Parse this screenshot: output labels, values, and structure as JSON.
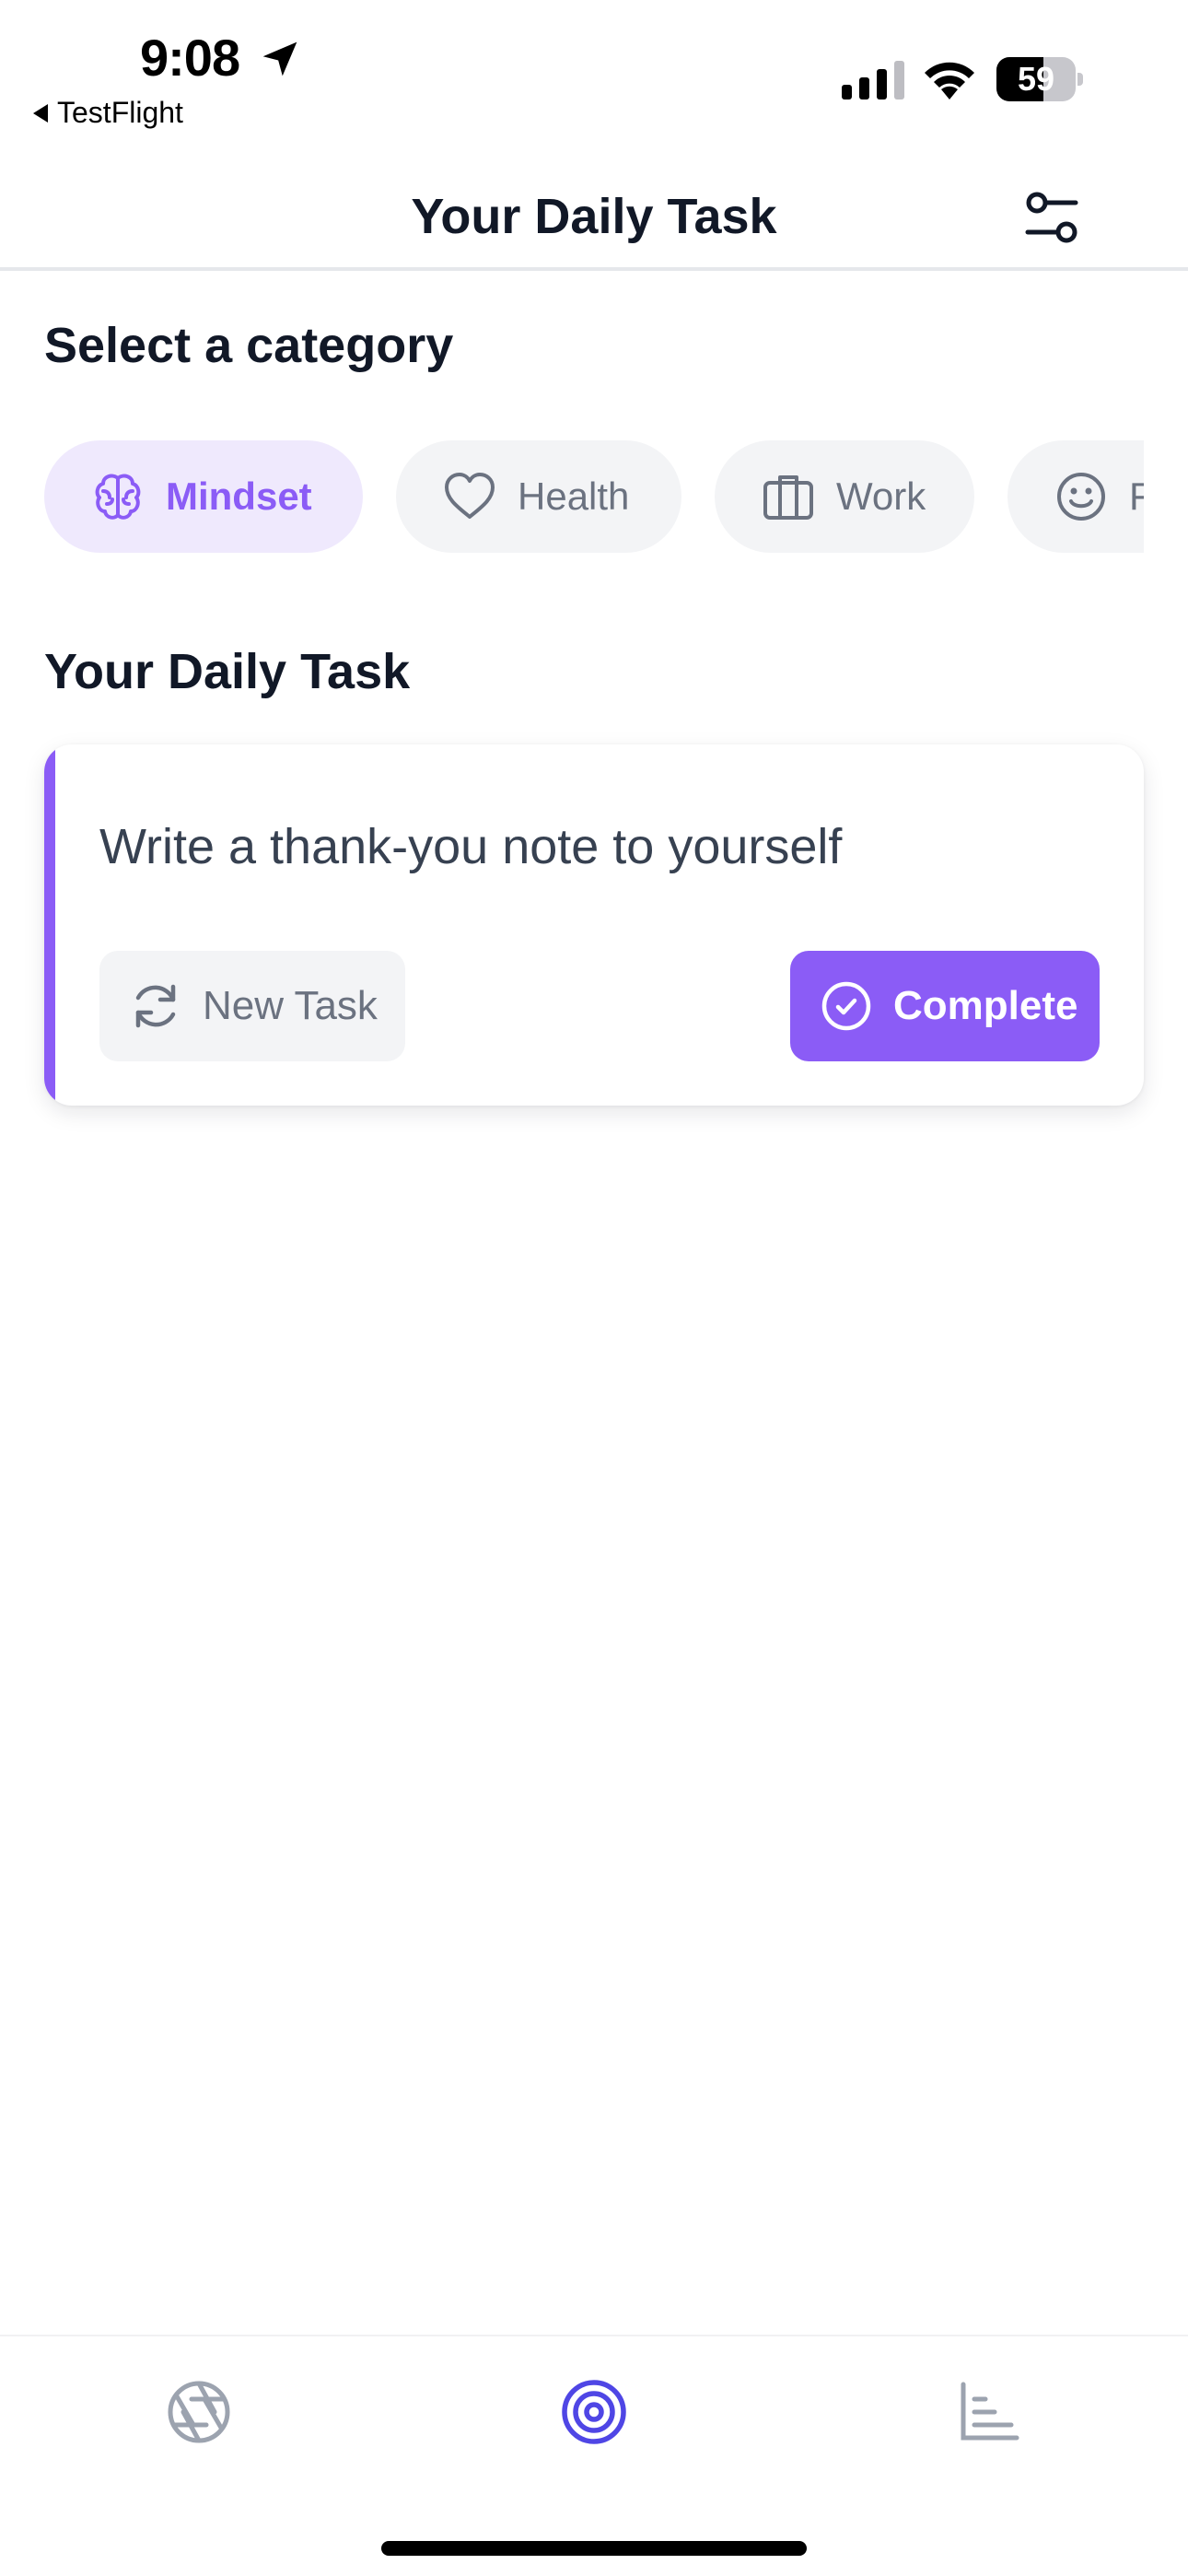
{
  "status_bar": {
    "time": "9:08",
    "back_app": "TestFlight",
    "battery_level": "59",
    "battery_fraction": 0.59
  },
  "header": {
    "title": "Your Daily Task",
    "filter_icon": "sliders-icon"
  },
  "categories": {
    "title": "Select a category",
    "items": [
      {
        "label": "Mindset",
        "icon": "brain-icon",
        "active": true
      },
      {
        "label": "Health",
        "icon": "heart-icon",
        "active": false
      },
      {
        "label": "Work",
        "icon": "briefcase-icon",
        "active": false
      },
      {
        "label": "F",
        "icon": "smile-icon",
        "active": false
      }
    ]
  },
  "daily_task": {
    "title": "Your Daily Task",
    "task_text": "Write a thank-you note to yourself",
    "new_task_label": "New Task",
    "complete_label": "Complete"
  },
  "tab_bar": {
    "items": [
      {
        "icon": "aperture-icon",
        "active": false
      },
      {
        "icon": "target-icon",
        "active": true
      },
      {
        "icon": "bar-chart-icon",
        "active": false
      }
    ]
  },
  "colors": {
    "accent": "#8b5cf6",
    "accent_tint": "#efe9fd",
    "tab_active": "#4f46e5",
    "muted": "#6b7280",
    "chip_bg": "#f3f4f6"
  }
}
